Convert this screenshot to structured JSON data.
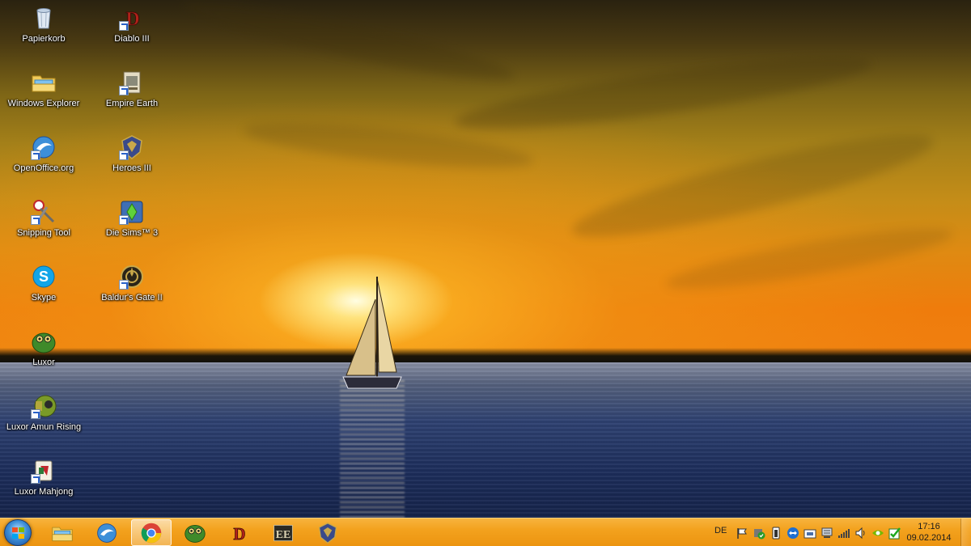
{
  "desktop": {
    "icons": [
      {
        "label": "Papierkorb",
        "icon": "recycle-bin-icon"
      },
      {
        "label": "Windows Explorer",
        "icon": "folder-icon"
      },
      {
        "label": "OpenOffice.org",
        "icon": "openoffice-icon"
      },
      {
        "label": "Snipping Tool",
        "icon": "scissors-icon"
      },
      {
        "label": "Skype",
        "icon": "skype-icon"
      },
      {
        "label": "Luxor",
        "icon": "luxor-icon"
      },
      {
        "label": "Luxor Amun Rising",
        "icon": "luxor-amun-icon"
      },
      {
        "label": "Luxor Mahjong",
        "icon": "mahjong-icon"
      },
      {
        "label": "Diablo III",
        "icon": "diablo-icon"
      },
      {
        "label": "Empire Earth",
        "icon": "empire-earth-icon"
      },
      {
        "label": "Heroes III",
        "icon": "heroes-icon"
      },
      {
        "label": "Die Sims™ 3",
        "icon": "sims-icon"
      },
      {
        "label": "Baldur's Gate II",
        "icon": "baldurs-gate-icon"
      }
    ]
  },
  "taskbar": {
    "pinned": [
      {
        "icon": "folder-icon",
        "active": false
      },
      {
        "icon": "openoffice-icon",
        "active": false
      },
      {
        "icon": "chrome-icon",
        "active": true
      },
      {
        "icon": "luxor-icon",
        "active": false
      },
      {
        "icon": "diablo-icon",
        "active": false
      },
      {
        "icon": "empire-earth-icon",
        "active": false
      },
      {
        "icon": "heroes-icon",
        "active": false
      }
    ],
    "tray": {
      "language": "DE",
      "icons": [
        "action-center-flag-icon",
        "security-icon",
        "power-icon",
        "teamviewer-icon",
        "network-adapter-icon",
        "network-icon",
        "signal-bars-icon",
        "volume-icon",
        "nvidia-icon",
        "update-icon"
      ],
      "time": "17:16",
      "date": "09.02.2014"
    }
  },
  "colors": {
    "taskbar": "#f3a21e",
    "sky_top": "#2a2210",
    "sky_horizon": "#f08010",
    "water": "#1d2e5c"
  }
}
